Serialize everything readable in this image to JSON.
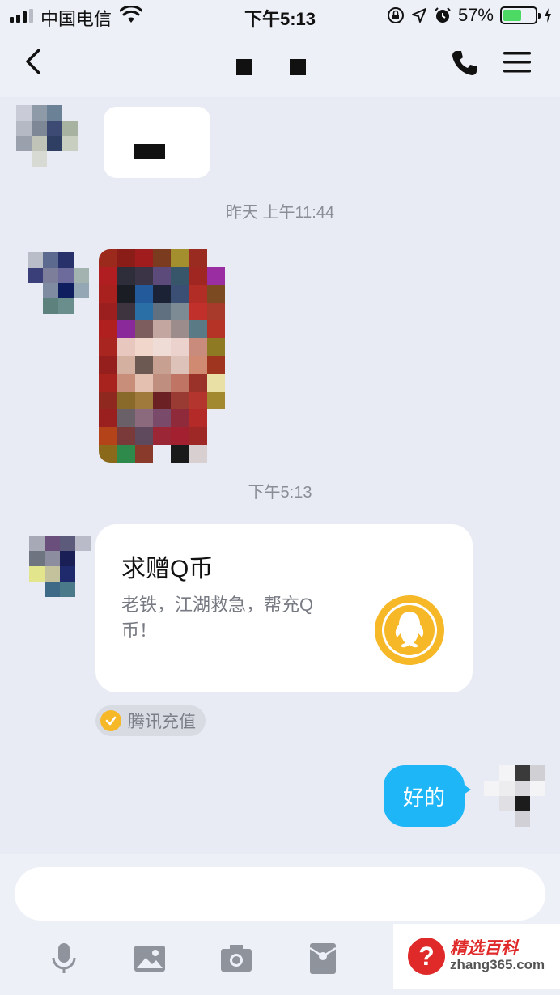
{
  "status_bar": {
    "carrier": "中国电信",
    "time": "下午5:13",
    "battery": "57%",
    "battery_level": 0.57
  },
  "chat": {
    "timestamps": [
      "昨天 上午11:44",
      "下午5:13"
    ],
    "card": {
      "title": "求赠Q币",
      "description": "老铁，江湖救急，帮充Q币！",
      "icon": "qq-penguin-icon",
      "source_label": "腾讯充值"
    },
    "reply_text": "好的"
  },
  "input": {
    "placeholder": "",
    "tools": [
      "microphone-icon",
      "image-icon",
      "camera-icon",
      "red-packet-icon"
    ]
  },
  "watermark": {
    "badge": "?",
    "title": "精选百科",
    "url": "zhang365.com"
  },
  "colors": {
    "background": "#e9ebf4",
    "reply_bubble": "#1eb6f7",
    "accent_gold": "#f6b827"
  }
}
